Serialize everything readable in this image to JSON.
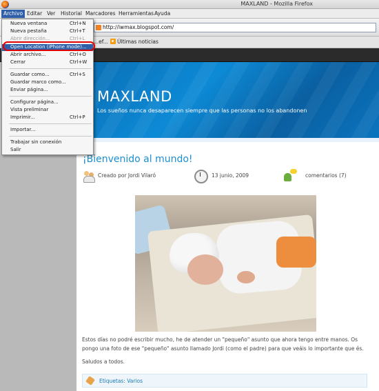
{
  "window": {
    "title": "MAXLAND - Mozilla Firefox"
  },
  "menubar": {
    "items": [
      "Archivo",
      "Editar",
      "Ver",
      "Historial",
      "Marcadores",
      "Herramientas",
      "Ayuda"
    ],
    "active": "Archivo"
  },
  "navbar": {
    "url": "http://iwmax.blogspot.com/"
  },
  "bookmarks": {
    "partial": "...ef...",
    "news": "Últimas noticias"
  },
  "archivo_menu": {
    "nueva_ventana": {
      "label": "Nueva ventana",
      "shortcut": "Ctrl+N"
    },
    "nueva_pestana": {
      "label": "Nueva pestaña",
      "shortcut": "Ctrl+T"
    },
    "abrir_direccion": {
      "label": "Abrir dirección...",
      "shortcut": "Ctrl+L"
    },
    "open_location": {
      "label": "Open Location (iPhone mode)..."
    },
    "abrir_archivo": {
      "label": "Abrir archivo...",
      "shortcut": "Ctrl+O"
    },
    "cerrar": {
      "label": "Cerrar",
      "shortcut": "Ctrl+W"
    },
    "guardar_como": {
      "label": "Guardar como...",
      "shortcut": "Ctrl+S"
    },
    "guardar_marco": {
      "label": "Guardar marco como..."
    },
    "enviar_pagina": {
      "label": "Enviar página..."
    },
    "configurar_pagina": {
      "label": "Configurar página..."
    },
    "vista_preliminar": {
      "label": "Vista preliminar"
    },
    "imprimir": {
      "label": "Imprimir...",
      "shortcut": "Ctrl+P"
    },
    "importar": {
      "label": "Importar..."
    },
    "trabajar_sin_conexion": {
      "label": "Trabajar sin conexión"
    },
    "salir": {
      "label": "Salir"
    }
  },
  "blog": {
    "title": "MAXLAND",
    "tagline": "Los sueños nunca desaparecen siempre que las personas no los abandonen",
    "post": {
      "title": "¡Bienvenido al mundo!",
      "author": "Creado por Jordi Vilaró",
      "date": "13 junio, 2009",
      "comments": "comentarios (7)",
      "paragraph1": "Estos días no podré escribir mucho, he de atender un \"pequeño\" asunto que ahora tengo entre manos. Os pongo una foto de ese \"pequeño\" asunto llamado Jordi (como el padre) para que veáis lo importante que és.",
      "paragraph2": "Saludos a todos.",
      "labels": "Etiquetas: Varios"
    }
  },
  "colors": {
    "accent": "#2f5fa8",
    "link": "#1b8fd1",
    "highlight_ring": "#e30000",
    "header": "#0a6db3"
  }
}
